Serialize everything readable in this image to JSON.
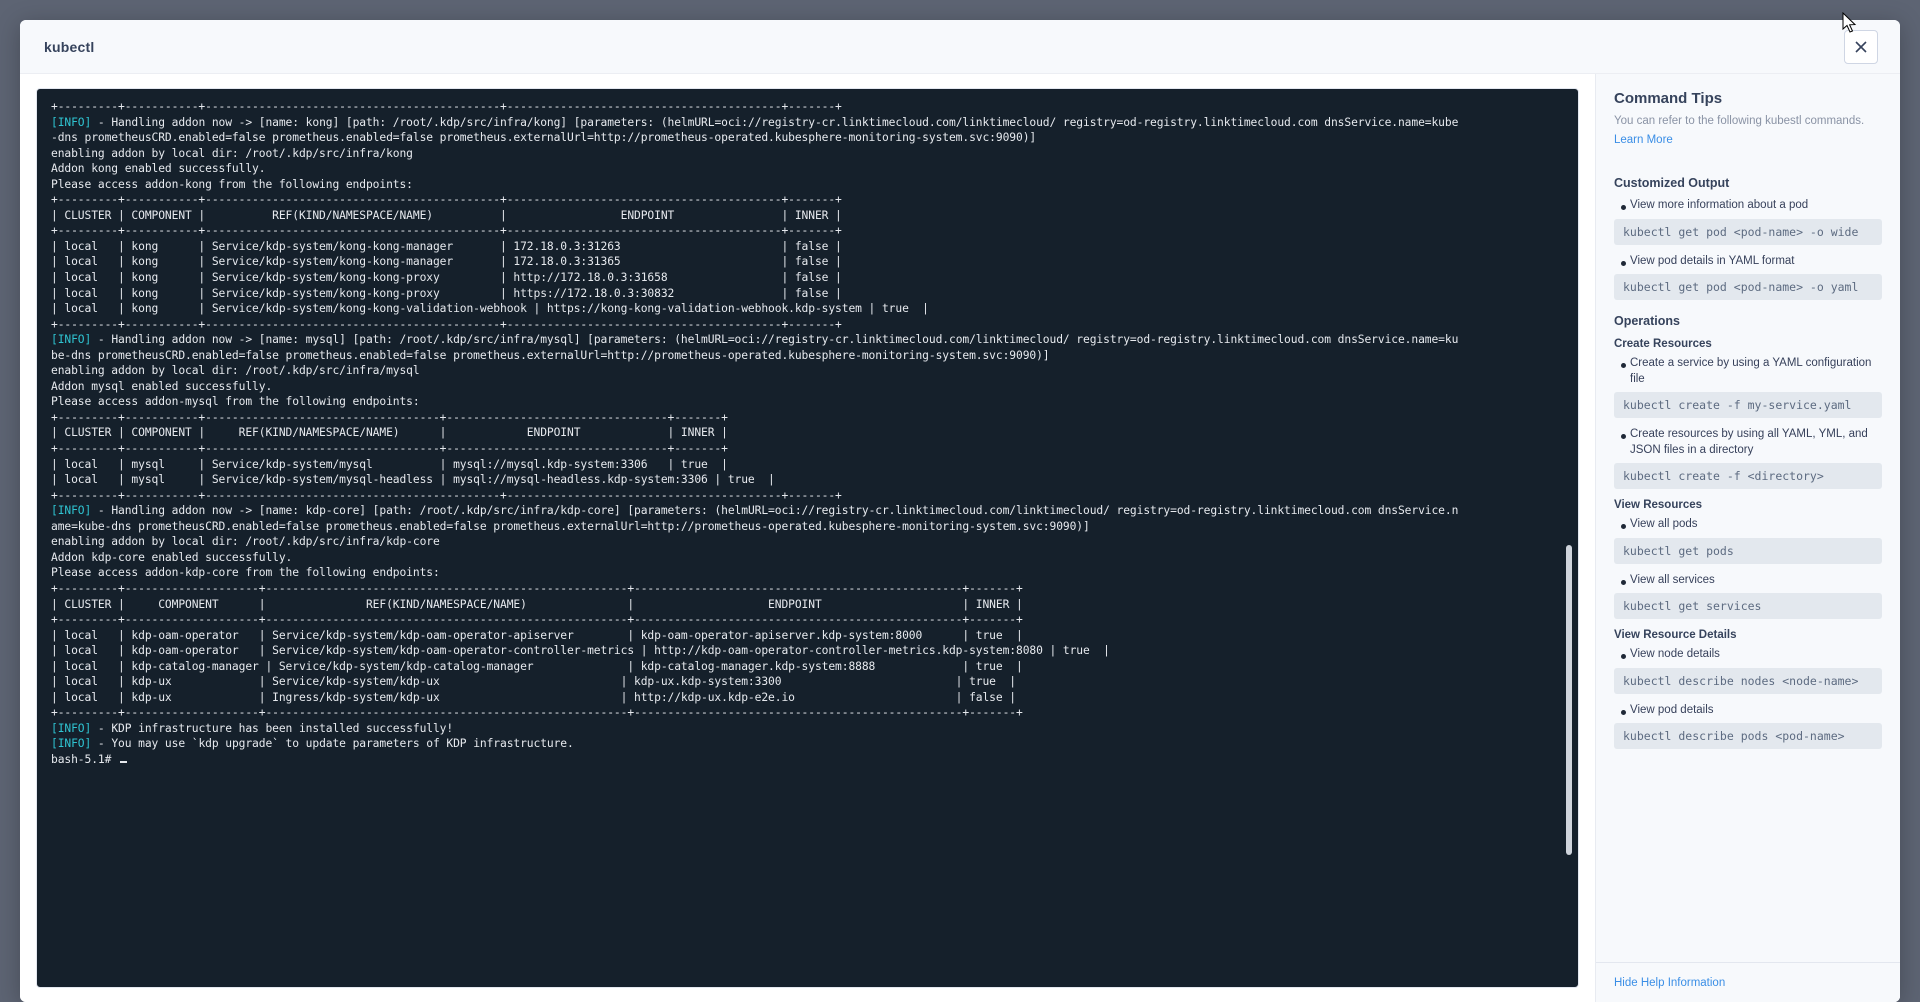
{
  "window": {
    "title": "kubectl",
    "close_icon": "close-icon"
  },
  "terminal": {
    "prompt": "bash-5.1#",
    "lines": [
      {
        "text": "+---------+-----------+--------------------------------------------+-----------------------------------------+-------+"
      },
      {
        "prefix": "[INFO]",
        "text": " - Handling addon now -> [name: kong] [path: /root/.kdp/src/infra/kong] [parameters: (helmURL=oci://registry-cr.linktimecloud.com/linktimecloud/ registry=od-registry.linktimecloud.com dnsService.name=kube"
      },
      {
        "text": "-dns prometheusCRD.enabled=false prometheus.enabled=false prometheus.externalUrl=http://prometheus-operated.kubesphere-monitoring-system.svc:9090)]"
      },
      {
        "text": "enabling addon by local dir: /root/.kdp/src/infra/kong"
      },
      {
        "text": "Addon kong enabled successfully."
      },
      {
        "text": "Please access addon-kong from the following endpoints:"
      },
      {
        "text": "+---------+-----------+--------------------------------------------+-----------------------------------------+-------+"
      },
      {
        "text": "| CLUSTER | COMPONENT |          REF(KIND/NAMESPACE/NAME)          |                 ENDPOINT                | INNER |"
      },
      {
        "text": "+---------+-----------+--------------------------------------------+-----------------------------------------+-------+"
      },
      {
        "text": "| local   | kong      | Service/kdp-system/kong-kong-manager       | 172.18.0.3:31263                        | false |"
      },
      {
        "text": "| local   | kong      | Service/kdp-system/kong-kong-manager       | 172.18.0.3:31365                        | false |"
      },
      {
        "text": "| local   | kong      | Service/kdp-system/kong-kong-proxy         | http://172.18.0.3:31658                 | false |"
      },
      {
        "text": "| local   | kong      | Service/kdp-system/kong-kong-proxy         | https://172.18.0.3:30832                | false |"
      },
      {
        "text": "| local   | kong      | Service/kdp-system/kong-kong-validation-webhook | https://kong-kong-validation-webhook.kdp-system | true  |"
      },
      {
        "text": "+---------+-----------+--------------------------------------------+-----------------------------------------+-------+"
      },
      {
        "prefix": "[INFO]",
        "text": " - Handling addon now -> [name: mysql] [path: /root/.kdp/src/infra/mysql] [parameters: (helmURL=oci://registry-cr.linktimecloud.com/linktimecloud/ registry=od-registry.linktimecloud.com dnsService.name=ku"
      },
      {
        "text": "be-dns prometheusCRD.enabled=false prometheus.enabled=false prometheus.externalUrl=http://prometheus-operated.kubesphere-monitoring-system.svc:9090)]"
      },
      {
        "text": "enabling addon by local dir: /root/.kdp/src/infra/mysql"
      },
      {
        "text": "Addon mysql enabled successfully."
      },
      {
        "text": "Please access addon-mysql from the following endpoints:"
      },
      {
        "text": "+---------+-----------+-----------------------------------+---------------------------------+-------+"
      },
      {
        "text": "| CLUSTER | COMPONENT |     REF(KIND/NAMESPACE/NAME)      |            ENDPOINT             | INNER |"
      },
      {
        "text": "+---------+-----------+-----------------------------------+---------------------------------+-------+"
      },
      {
        "text": "| local   | mysql     | Service/kdp-system/mysql          | mysql://mysql.kdp-system:3306   | true  |"
      },
      {
        "text": "| local   | mysql     | Service/kdp-system/mysql-headless | mysql://mysql-headless.kdp-system:3306 | true  |"
      },
      {
        "text": "+---------+-----------+--------------------------------------------+-----------------------------------------+-------+"
      },
      {
        "prefix": "[INFO]",
        "text": " - Handling addon now -> [name: kdp-core] [path: /root/.kdp/src/infra/kdp-core] [parameters: (helmURL=oci://registry-cr.linktimecloud.com/linktimecloud/ registry=od-registry.linktimecloud.com dnsService.n"
      },
      {
        "text": "ame=kube-dns prometheusCRD.enabled=false prometheus.enabled=false prometheus.externalUrl=http://prometheus-operated.kubesphere-monitoring-system.svc:9090)]"
      },
      {
        "text": "enabling addon by local dir: /root/.kdp/src/infra/kdp-core"
      },
      {
        "text": "Addon kdp-core enabled successfully."
      },
      {
        "text": "Please access addon-kdp-core from the following endpoints:"
      },
      {
        "text": "+---------+--------------------+------------------------------------------------------+-------------------------------------------------+-------+"
      },
      {
        "text": "| CLUSTER |     COMPONENT      |               REF(KIND/NAMESPACE/NAME)               |                    ENDPOINT                     | INNER |"
      },
      {
        "text": "+---------+--------------------+------------------------------------------------------+-------------------------------------------------+-------+"
      },
      {
        "text": "| local   | kdp-oam-operator   | Service/kdp-system/kdp-oam-operator-apiserver        | kdp-oam-operator-apiserver.kdp-system:8000      | true  |"
      },
      {
        "text": "| local   | kdp-oam-operator   | Service/kdp-system/kdp-oam-operator-controller-metrics | http://kdp-oam-operator-controller-metrics.kdp-system:8080 | true  |"
      },
      {
        "text": "| local   | kdp-catalog-manager | Service/kdp-system/kdp-catalog-manager              | kdp-catalog-manager.kdp-system:8888             | true  |"
      },
      {
        "text": "| local   | kdp-ux             | Service/kdp-system/kdp-ux                           | kdp-ux.kdp-system:3300                          | true  |"
      },
      {
        "text": "| local   | kdp-ux             | Ingress/kdp-system/kdp-ux                           | http://kdp-ux.kdp-e2e.io                        | false |"
      },
      {
        "text": "+---------+--------------------+------------------------------------------------------+-------------------------------------------------+-------+"
      },
      {
        "prefix": "[INFO]",
        "text": " - KDP infrastructure has been installed successfully!"
      },
      {
        "prefix": "[INFO]",
        "text": " - You may use `kdp upgrade` to update parameters of KDP infrastructure."
      }
    ]
  },
  "help": {
    "title": "Command Tips",
    "subtitle": "You can refer to the following kubestl commands.",
    "learn_more": "Learn More",
    "hide_help": "Hide Help Information",
    "sections": [
      {
        "heading": "Customized Output",
        "level": "h2",
        "tips": [
          {
            "desc": "View more information about a pod",
            "cmd": "kubectl get pod <pod-name> -o wide"
          },
          {
            "desc": "View pod details in YAML format",
            "cmd": "kubectl get pod <pod-name> -o yaml"
          }
        ]
      },
      {
        "heading": "Operations",
        "level": "h2",
        "tips": []
      },
      {
        "heading": "Create Resources",
        "level": "h3",
        "tips": [
          {
            "desc": "Create a service by using a YAML configuration file",
            "cmd": "kubectl create -f my-service.yaml"
          },
          {
            "desc": "Create resources by using all YAML, YML, and JSON files in a directory",
            "cmd": "kubectl create -f <directory>"
          }
        ]
      },
      {
        "heading": "View Resources",
        "level": "h3",
        "tips": [
          {
            "desc": "View all pods",
            "cmd": "kubectl get pods"
          },
          {
            "desc": "View all services",
            "cmd": "kubectl get services"
          }
        ]
      },
      {
        "heading": "View Resource Details",
        "level": "h3",
        "tips": [
          {
            "desc": "View node details",
            "cmd": "kubectl describe nodes <node-name>"
          },
          {
            "desc": "View pod details",
            "cmd": "kubectl describe pods <pod-name>"
          }
        ]
      }
    ]
  },
  "colors": {
    "accent_link": "#3a8ee6",
    "terminal_bg": "#15202b",
    "info_tag": "#2fc4d2",
    "page_bg": "#5d6473"
  }
}
